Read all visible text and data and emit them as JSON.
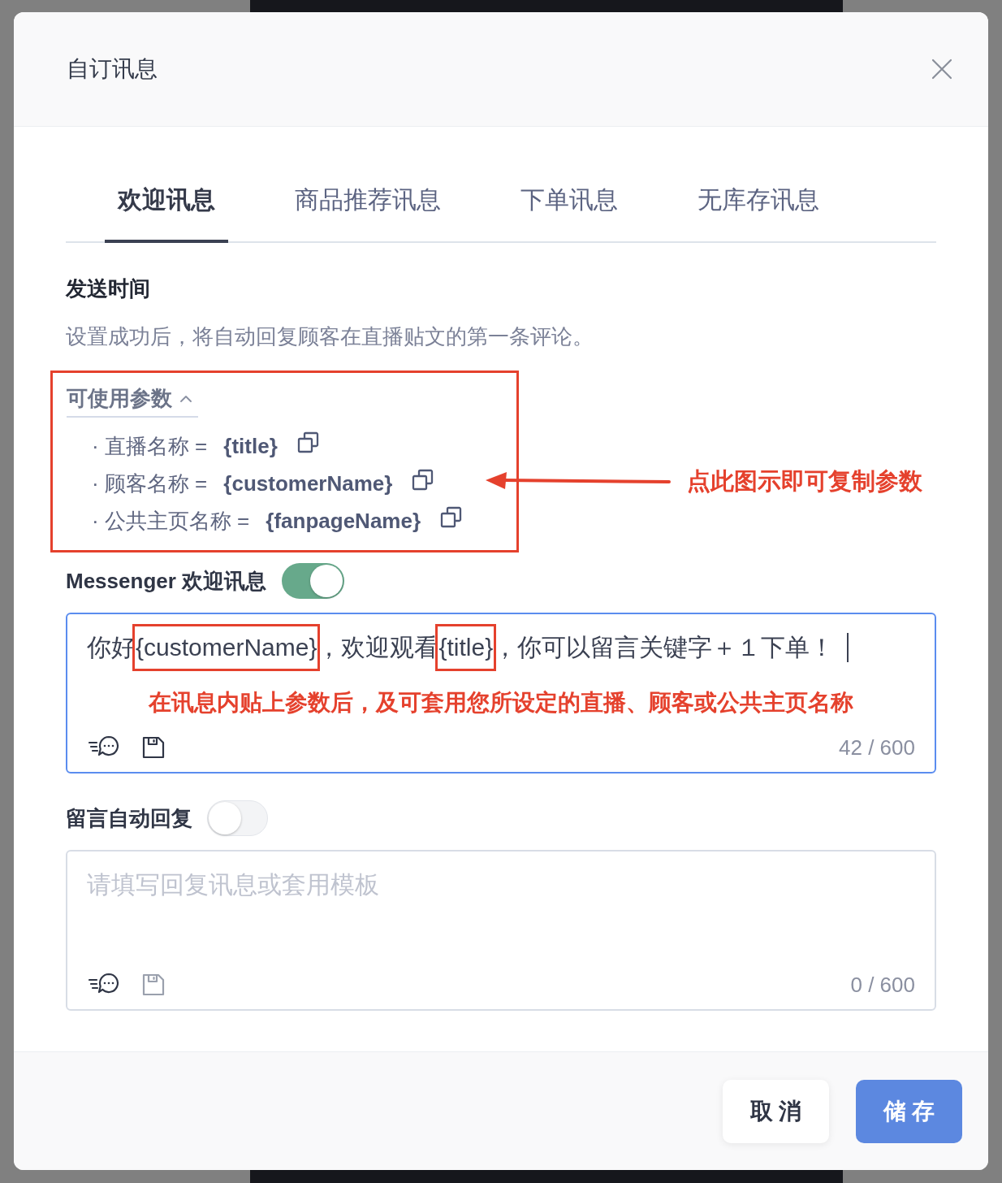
{
  "dialog": {
    "title": "自订讯息"
  },
  "tabs": [
    {
      "label": "欢迎讯息",
      "selected": true
    },
    {
      "label": "商品推荐讯息",
      "selected": false
    },
    {
      "label": "下单讯息",
      "selected": false
    },
    {
      "label": "无库存讯息",
      "selected": false
    }
  ],
  "send_time": {
    "heading": "发送时间",
    "description": "设置成功后，将自动回复顾客在直播贴文的第一条评论。"
  },
  "parameters": {
    "label": "可使用参数",
    "expanded": true,
    "items": [
      {
        "name": "· 直播名称 =",
        "value": "{title}"
      },
      {
        "name": "· 顾客名称 =",
        "value": "{customerName}"
      },
      {
        "name": "· 公共主页名称 =",
        "value": "{fanpageName}"
      }
    ],
    "copy_hint": "点此图示即可复制参数"
  },
  "messenger_welcome": {
    "label": "Messenger 欢迎讯息",
    "on": true,
    "editor": {
      "focused": true,
      "segments": [
        {
          "text": "你好",
          "highlighted": false
        },
        {
          "text": "{customerName}",
          "highlighted": true
        },
        {
          "text": "，欢迎观看",
          "highlighted": false
        },
        {
          "text": "{title}",
          "highlighted": true
        },
        {
          "text": "，你可以留言关键字＋１下单！",
          "highlighted": false
        }
      ],
      "paste_hint": "在讯息内贴上参数后，及可套用您所设定的直播、顾客或公共主页名称",
      "counter": "42 / 600",
      "save_disabled": false
    }
  },
  "comment_auto_reply": {
    "label": "留言自动回复",
    "on": false,
    "editor": {
      "focused": false,
      "placeholder": "请填写回复讯息或套用模板",
      "counter": "0 / 600",
      "save_disabled": true
    }
  },
  "buttons": [
    {
      "label": "取 消",
      "kind": "secondary"
    },
    {
      "label": "储 存",
      "kind": "primary"
    }
  ]
}
